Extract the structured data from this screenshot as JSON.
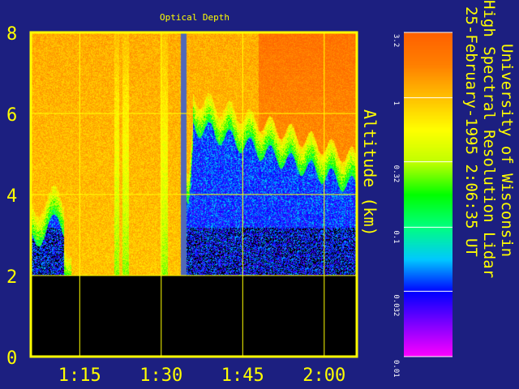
{
  "chart_data": {
    "type": "heatmap",
    "title": "Optical Depth",
    "ylabel": "Altitude (km)",
    "xlabel": "",
    "x_ticks": [
      "1:15",
      "1:30",
      "1:45",
      "2:00"
    ],
    "y_ticks": [
      "0",
      "2",
      "4",
      "6",
      "8"
    ],
    "ylim": [
      0,
      8
    ],
    "xlim": [
      "1:06",
      "2:06"
    ],
    "grid": true,
    "colorbar": {
      "scale": "log",
      "ticks": [
        "3.2",
        "1",
        "0.32",
        "0.1",
        "0.032",
        "0.01"
      ],
      "range": [
        0.01,
        3.2
      ],
      "colors": [
        "#ff00ff",
        "#8000ff",
        "#0000ff",
        "#00c8ff",
        "#00ff80",
        "#00ff00",
        "#c0ff00",
        "#ffff00",
        "#ffc000",
        "#ff8000",
        "#ff6000"
      ]
    },
    "features": {
      "no_data_below_km": 2.0,
      "missing_data_time": "1:34",
      "cloud_base_start_km": 4.5,
      "cloud_base_end_km": 4.2
    }
  },
  "caption": {
    "line1": "University of Wisconsin",
    "line2": "High Spectral Resolution Lidar",
    "line3": "25-February-1995   2:06:35 UT"
  },
  "colors": {
    "background": "#1c1f80",
    "axis": "#ffff00",
    "no_data": "#000000",
    "missing_column": "#5068b8"
  }
}
